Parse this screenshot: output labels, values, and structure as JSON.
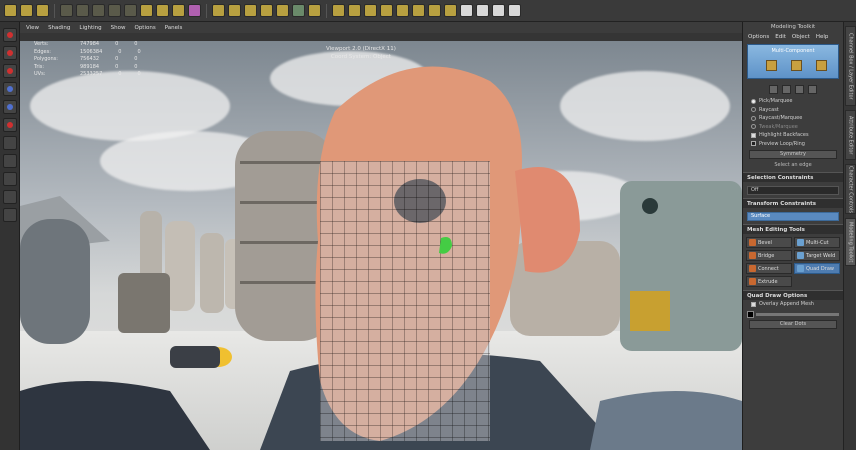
{
  "viewport": {
    "menu": [
      "View",
      "Shading",
      "Lighting",
      "Show",
      "Options",
      "Panels"
    ],
    "hud": [
      {
        "label": "Verts:",
        "value": "747984",
        "a": "0",
        "b": "0"
      },
      {
        "label": "Edges:",
        "value": "1506384",
        "a": "0",
        "b": "0"
      },
      {
        "label": "Polygons:",
        "value": "756432",
        "a": "0",
        "b": "0"
      },
      {
        "label": "Tris:",
        "value": "989184",
        "a": "0",
        "b": "0"
      },
      {
        "label": "UVs:",
        "value": "2533257",
        "a": "0",
        "b": "0"
      }
    ],
    "title_line1": "Viewport 2.0 (DirectX 11)",
    "title_line2": "Coord System: Object"
  },
  "panel": {
    "title": "Modeling Toolkit",
    "menu": [
      "Options",
      "Edit",
      "Object",
      "Help"
    ],
    "multi_component": "Multi-Component",
    "pick_marquee": "Pick/Marquee",
    "raycast": "Raycast",
    "raycast_marquee": "Raycast/Marquee",
    "tweak_marquee": "Tweak/Marquee",
    "highlight_backfaces": "Highlight Backfaces",
    "preview_loop_ring": "Preview Loop/Ring",
    "symmetry_button": "Symmetry",
    "select_hint": "Select an edge",
    "selection_constraints": "Selection Constraints",
    "constraint_value": "Off",
    "transform_constraints": "Transform Constraints",
    "transform_value": "Surface",
    "mesh_editing_tools": "Mesh Editing Tools",
    "tools": [
      {
        "label": "Bevel",
        "selected": false
      },
      {
        "label": "Multi-Cut",
        "selected": false
      },
      {
        "label": "Bridge",
        "selected": false
      },
      {
        "label": "Target Weld",
        "selected": false
      },
      {
        "label": "Connect",
        "selected": false
      },
      {
        "label": "Quad Draw",
        "selected": true
      },
      {
        "label": "Extrude",
        "selected": false
      }
    ],
    "quad_draw_options": "Quad Draw Options",
    "overlay_append_mesh": "Overlay Append Mesh",
    "clear_dots": "Clear Dots"
  },
  "side_tabs": [
    "Channel Box / Layer Editor",
    "Attribute Editor",
    "Character Controls",
    "Modeling Toolkit"
  ],
  "colors": {
    "accent": "#5a8ac0",
    "panel": "#3d3d3d",
    "selection": "#4e7cb0"
  }
}
